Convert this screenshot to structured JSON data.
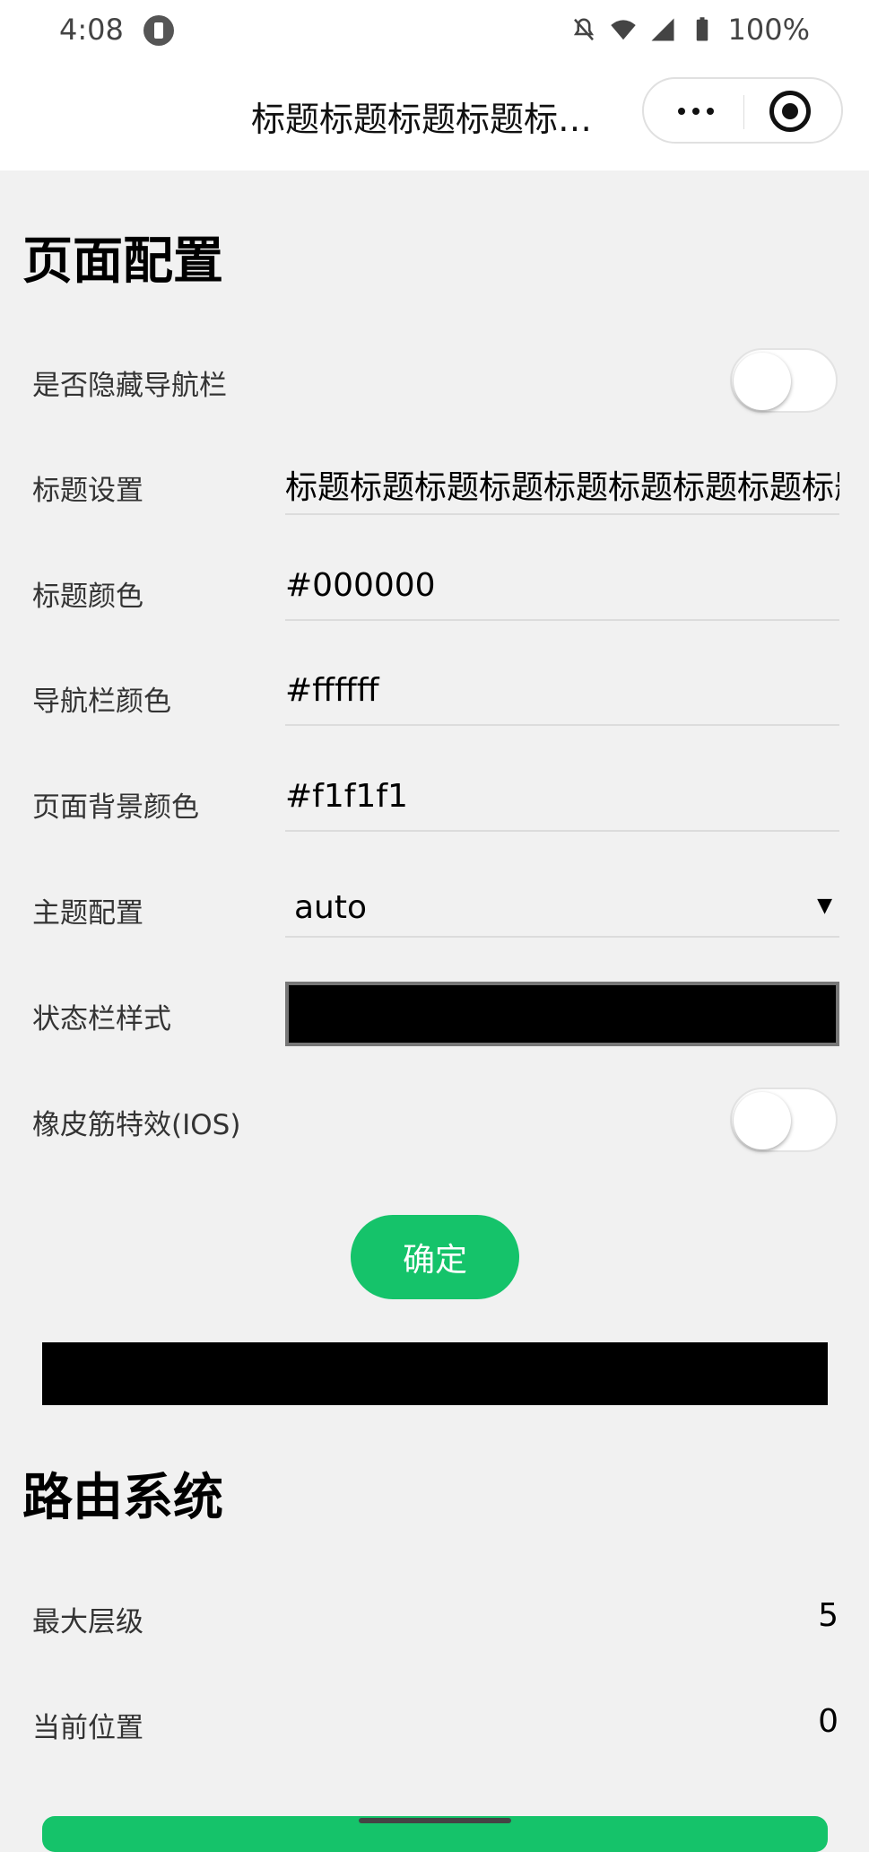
{
  "status_bar": {
    "time": "4:08",
    "battery": "100%",
    "icons": [
      "app-icon",
      "bell-off-icon",
      "wifi-icon",
      "signal-icon",
      "battery-icon"
    ]
  },
  "nav": {
    "title": "标题标题标题标题标题标题标题标题标题标题"
  },
  "page_config": {
    "title": "页面配置",
    "hide_nav_label": "是否隐藏导航栏",
    "hide_nav_on": false,
    "title_setting_label": "标题设置",
    "title_setting_value": "标题标题标题标题标题标题标题标题标题标题",
    "title_color_label": "标题颜色",
    "title_color_value": "#000000",
    "nav_color_label": "导航栏颜色",
    "nav_color_value": "#ffffff",
    "bg_color_label": "页面背景颜色",
    "bg_color_value": "#f1f1f1",
    "theme_label": "主题配置",
    "theme_value": "auto",
    "statusbar_style_label": "状态栏样式",
    "bounce_label": "橡皮筋特效(IOS)",
    "bounce_on": false,
    "confirm_label": "确定"
  },
  "router": {
    "title": "路由系统",
    "max_level_label": "最大层级",
    "max_level_value": "5",
    "current_pos_label": "当前位置",
    "current_pos_value": "0"
  },
  "colors": {
    "accent": "#15c36a",
    "background": "#f1f1f1"
  }
}
